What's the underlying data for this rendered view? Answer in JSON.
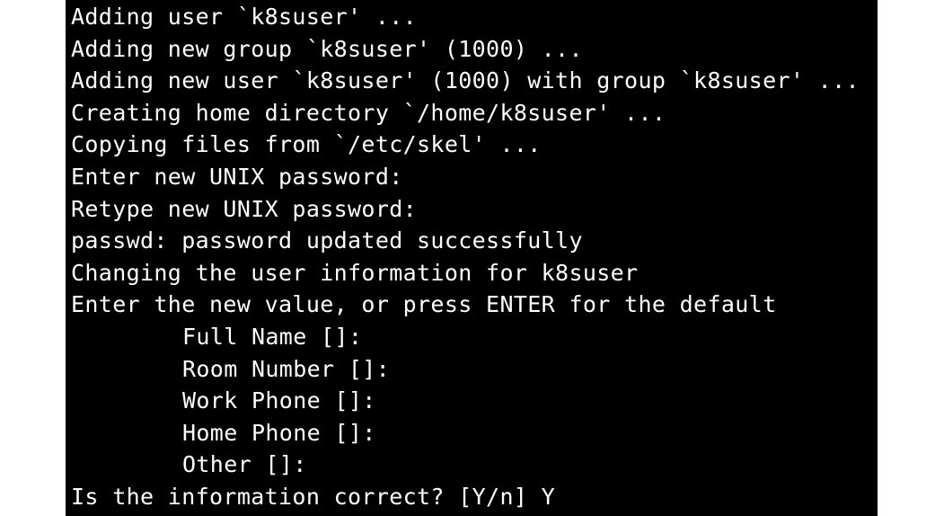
{
  "terminal": {
    "background": "#000000",
    "foreground": "#ffffff",
    "lines": [
      "Adding user `k8suser' ...",
      "Adding new group `k8suser' (1000) ...",
      "Adding new user `k8suser' (1000) with group `k8suser' ...",
      "Creating home directory `/home/k8suser' ...",
      "Copying files from `/etc/skel' ...",
      "Enter new UNIX password:",
      "Retype new UNIX password:",
      "passwd: password updated successfully",
      "Changing the user information for k8suser",
      "Enter the new value, or press ENTER for the default",
      "Full Name []:",
      "Room Number []:",
      "Work Phone []:",
      "Home Phone []:",
      "Other []:",
      "Is the information correct? [Y/n] Y"
    ]
  }
}
